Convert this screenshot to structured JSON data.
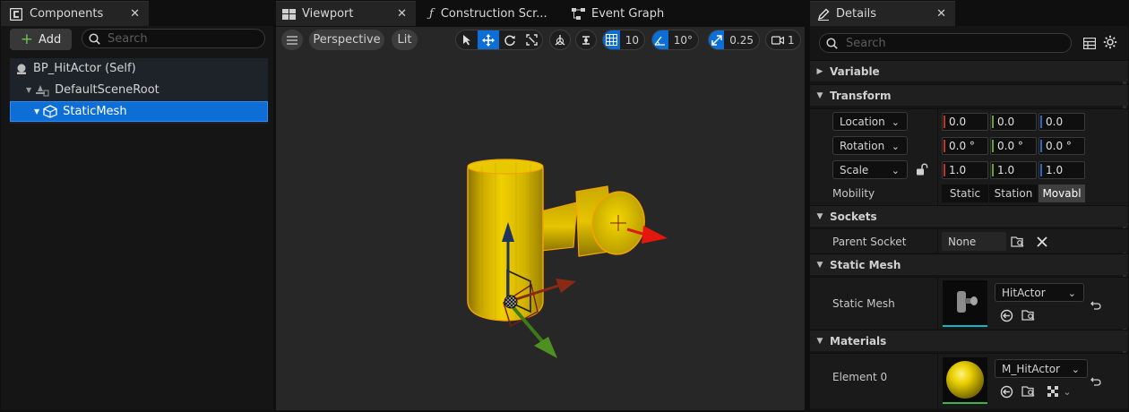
{
  "components_panel": {
    "tab_label": "Components",
    "add_label": "Add",
    "search_placeholder": "Search",
    "tree": [
      {
        "label": "BP_HitActor (Self)"
      },
      {
        "label": "DefaultSceneRoot"
      },
      {
        "label": "StaticMesh"
      }
    ]
  },
  "editor_tabs": {
    "viewport": "Viewport",
    "construction": "Construction Scr...",
    "event_graph": "Event Graph"
  },
  "viewport_toolbar": {
    "view_mode": "Perspective",
    "lighting": "Lit",
    "grid_snap": "10",
    "rotation_snap": "10°",
    "scale_snap": "0.25",
    "camera_speed": "1"
  },
  "details": {
    "tab_label": "Details",
    "search_placeholder": "Search",
    "categories": {
      "variable": "Variable",
      "transform": "Transform",
      "sockets": "Sockets",
      "static_mesh": "Static Mesh",
      "materials": "Materials"
    },
    "transform": {
      "location_label": "Location",
      "location": [
        "0.0",
        "0.0",
        "0.0"
      ],
      "rotation_label": "Rotation",
      "rotation": [
        "0.0 °",
        "0.0 °",
        "0.0 °"
      ],
      "scale_label": "Scale",
      "scale": [
        "1.0",
        "1.0",
        "1.0"
      ],
      "mobility_label": "Mobility",
      "mobility_options": [
        "Static",
        "Station",
        "Movabl"
      ],
      "mobility_selected": "Movabl"
    },
    "sockets": {
      "parent_socket_label": "Parent Socket",
      "parent_socket_value": "None"
    },
    "static_mesh": {
      "label": "Static Mesh",
      "value": "HitActor"
    },
    "materials": {
      "element_label": "Element 0",
      "value": "M_HitActor"
    }
  },
  "colors": {
    "accent": "#0d6fd6",
    "axis_x": "#c8321e",
    "axis_y": "#6ba32a",
    "axis_z": "#2f67c4",
    "mesh_yellow": "#e6c200"
  }
}
